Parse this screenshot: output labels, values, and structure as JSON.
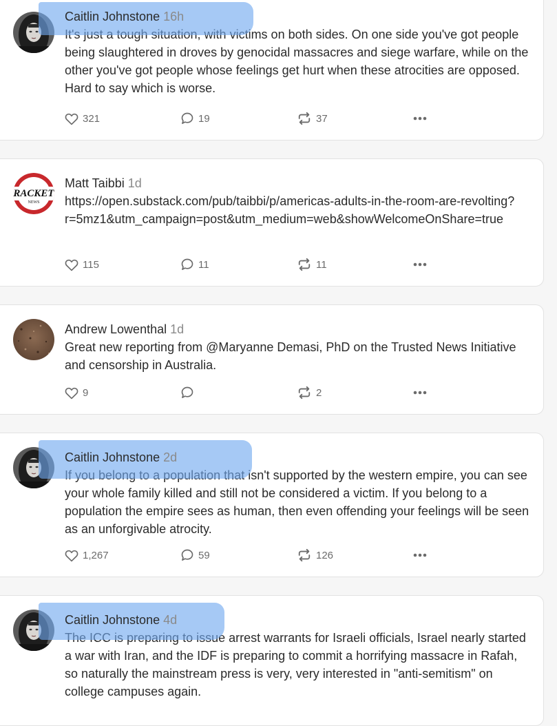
{
  "posts": [
    {
      "author": "Caitlin Johnstone",
      "time": "16h",
      "body": "It's just a tough situation, with victims on both sides. On one side you've got people being slaughtered in droves by genocidal massacres and siege warfare, while on the other you've got people whose feelings get hurt when these atrocities are opposed. Hard to say which is worse.",
      "likes": "321",
      "comments": "19",
      "restacks": "37",
      "avatar": "caitlin-portrait"
    },
    {
      "author": "Matt Taibbi",
      "time": "1d",
      "body": "https://open.substack.com/pub/taibbi/p/americas-adults-in-the-room-are-revolting?r=5mz1&utm_campaign=post&utm_medium=web&showWelcomeOnShare=true",
      "likes": "115",
      "comments": "11",
      "restacks": "11",
      "avatar": "racket-news-logo",
      "logo_text": "RACKET",
      "logo_subtext": "NEWS"
    },
    {
      "author": "Andrew Lowenthal",
      "time": "1d",
      "body": "Great new reporting from @Maryanne Demasi, PhD on the Trusted News Initiative and censorship in Australia.",
      "likes": "9",
      "comments": "",
      "restacks": "2",
      "avatar": "textured-brown"
    },
    {
      "author": "Caitlin Johnstone",
      "time": "2d",
      "body": "If you belong to a population that isn't supported by the western empire, you can see your whole family killed and still not be considered a victim. If you belong to a population the empire sees as human, then even offending your feelings will be seen as an unforgivable atrocity.",
      "likes": "1,267",
      "comments": "59",
      "restacks": "126",
      "avatar": "caitlin-portrait"
    },
    {
      "author": "Caitlin Johnstone",
      "time": "4d",
      "body": "The ICC is preparing to issue arrest warrants for Israeli officials, Israel nearly started a war with Iran, and the IDF is preparing to commit a horrifying massacre in Rafah, so naturally the mainstream press is very, very interested in \"anti-semitism\" on college campuses again.",
      "avatar": "caitlin-portrait"
    }
  ],
  "colors": {
    "highlight": "#6fa8ef",
    "text": "#2b2b2b",
    "muted": "#8a8a8a",
    "icon": "#6b6b6b",
    "racket_red": "#c8282c"
  },
  "icons": {
    "like": "heart-icon",
    "comment": "speech-bubble-icon",
    "restack": "restack-arrows-icon",
    "more": "ellipsis-icon"
  }
}
